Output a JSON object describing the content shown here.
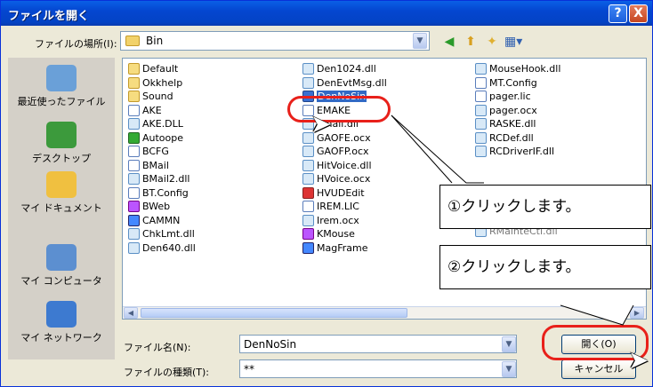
{
  "title": "ファイルを開く",
  "title_buttons": {
    "help": "?",
    "close": "X"
  },
  "lookin": {
    "label": "ファイルの場所(I):",
    "value": "Bin"
  },
  "places": [
    {
      "label": "最近使ったファイル",
      "icon": "recent-documents-icon",
      "color": "#6aa0d8"
    },
    {
      "label": "デスクトップ",
      "icon": "desktop-icon",
      "color": "#3c9a3c"
    },
    {
      "label": "マイ ドキュメント",
      "icon": "my-documents-icon",
      "color": "#f0c040"
    },
    {
      "label": "マイ コンピュータ",
      "icon": "my-computer-icon",
      "color": "#5c8fd0"
    },
    {
      "label": "マイ ネットワーク",
      "icon": "my-network-icon",
      "color": "#3d7ad0"
    }
  ],
  "files": {
    "col1": [
      {
        "name": "Default",
        "type": "folder"
      },
      {
        "name": "Okkhelp",
        "type": "folder"
      },
      {
        "name": "Sound",
        "type": "folder"
      },
      {
        "name": "AKE",
        "type": "cfg"
      },
      {
        "name": "AKE.DLL",
        "type": "dll"
      },
      {
        "name": "Autoope",
        "type": "green"
      },
      {
        "name": "BCFG",
        "type": "cfg"
      },
      {
        "name": "BMail",
        "type": "cfg"
      },
      {
        "name": "BMail2.dll",
        "type": "dll"
      },
      {
        "name": "BT.Config",
        "type": "cfg"
      },
      {
        "name": "BWeb",
        "type": "purple"
      },
      {
        "name": "CAMMN",
        "type": "blue"
      },
      {
        "name": "ChkLmt.dll",
        "type": "dll"
      },
      {
        "name": "Den640.dll",
        "type": "dll"
      }
    ],
    "col2": [
      {
        "name": "Den1024.dll",
        "type": "dll"
      },
      {
        "name": "DenEvtMsg.dll",
        "type": "dll"
      },
      {
        "name": "DenNoSin",
        "type": "exe",
        "selected": true
      },
      {
        "name": "EMAKE",
        "type": "cfg"
      },
      {
        "name": "email.dll",
        "type": "dll"
      },
      {
        "name": "GAOFE.ocx",
        "type": "dll"
      },
      {
        "name": "GAOFP.ocx",
        "type": "dll"
      },
      {
        "name": "HitVoice.dll",
        "type": "dll"
      },
      {
        "name": "HVoice.ocx",
        "type": "dll"
      },
      {
        "name": "HVUDEdit",
        "type": "red"
      },
      {
        "name": "IREM.LIC",
        "type": "cfg"
      },
      {
        "name": "Irem.ocx",
        "type": "dll"
      },
      {
        "name": "KMouse",
        "type": "purple"
      },
      {
        "name": "MagFrame",
        "type": "blue"
      }
    ],
    "col3": [
      {
        "name": "MouseHook.dll",
        "type": "dll"
      },
      {
        "name": "MT.Config",
        "type": "cfg"
      },
      {
        "name": "pager.lic",
        "type": "cfg"
      },
      {
        "name": "pager.ocx",
        "type": "dll"
      },
      {
        "name": "RASKE.dll",
        "type": "dll"
      },
      {
        "name": "RCDef.dll",
        "type": "dll"
      },
      {
        "name": "RCDriverIF.dll",
        "type": "dll"
      }
    ]
  },
  "filename": {
    "label": "ファイル名(N):",
    "value": "DenNoSin"
  },
  "filetype": {
    "label": "ファイルの種類(T):",
    "value": "**"
  },
  "buttons": {
    "open": "開く(O)",
    "cancel": "キャンセル"
  },
  "callouts": {
    "step1": "①クリックします。",
    "step2": "②クリックします。"
  },
  "partial_text": {
    "c3_overlap": "RMainteCtl.dll"
  },
  "colors": {
    "title_bar": "#0446d0",
    "selection": "#316ac5",
    "highlight_ring": "#e8201a"
  }
}
